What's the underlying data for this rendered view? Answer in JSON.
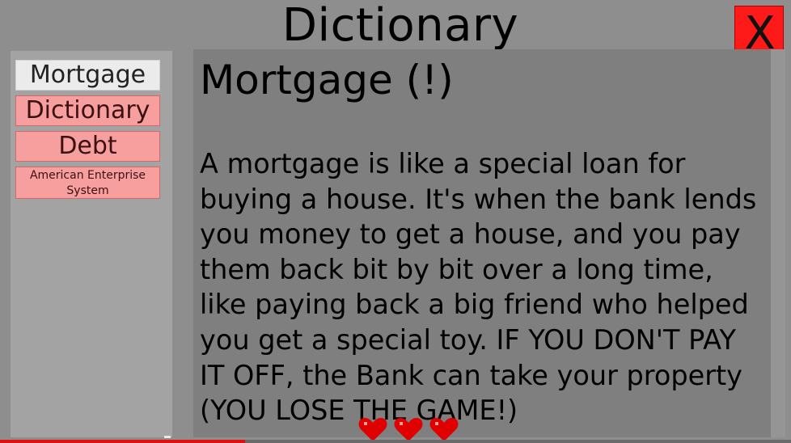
{
  "header": {
    "title": "Dictionary",
    "close_label": "X"
  },
  "sidebar": {
    "items": [
      {
        "label": "Mortgage (!)",
        "selected": true
      },
      {
        "label": "Dictionary",
        "selected": false
      },
      {
        "label": "Debt",
        "selected": false
      },
      {
        "label": "American Enterprise System",
        "selected": false
      }
    ]
  },
  "entry": {
    "word": "Mortgage (!)",
    "definition": "A mortgage is like a special loan for buying a house. It's when the bank lends you money to get a house, and you pay them back bit by bit over a long time, like paying back a big friend who helped you get a special toy. IF YOU DON'T PAY IT OFF, the Bank can take your property (YOU LOSE THE GAME!)"
  },
  "status": {
    "hearts": 3,
    "heart_icon": "heart-icon"
  },
  "video": {
    "progress": 0.31
  },
  "colors": {
    "background": "#8e8e8e",
    "close_button": "#ff1a1a",
    "list_item": "#f79e9e",
    "list_item_selected": "#ebebeb",
    "content_panel": "#7f7f7f",
    "heart": "#e00000"
  }
}
